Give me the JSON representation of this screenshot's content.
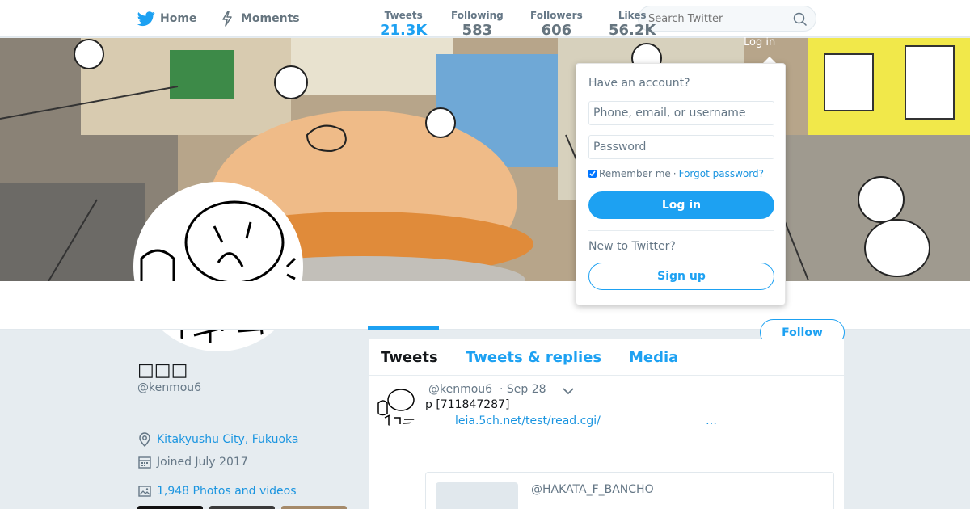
{
  "nav": {
    "home_label": "Home",
    "moments_label": "Moments",
    "search_placeholder": "Search Twitter",
    "login_label": "Log in"
  },
  "profile": {
    "name": "□□□",
    "handle": "@kenmou6",
    "location": "Kitakyushu City, Fukuoka",
    "joined": "Joined July 2017",
    "photos_link": "1,948 Photos and videos",
    "follow_label": "Follow"
  },
  "stats": [
    {
      "label": "Tweets",
      "value": "21.3K"
    },
    {
      "label": "Following",
      "value": "583"
    },
    {
      "label": "Followers",
      "value": "606"
    },
    {
      "label": "Likes",
      "value": "56.2K"
    }
  ],
  "tabs": [
    {
      "label": "Tweets"
    },
    {
      "label": "Tweets & replies"
    },
    {
      "label": "Media"
    }
  ],
  "tweet": {
    "handle": "@kenmou6",
    "date": "· Sep 28",
    "text": "p  [711847287]",
    "link": "leia.5ch.net/test/read.cgi/",
    "ellipsis": "…",
    "quote_handle": "@HAKATA_F_BANCHO"
  },
  "login_dropdown": {
    "title": "Have an account?",
    "username_placeholder": "Phone, email, or username",
    "password_placeholder": "Password",
    "remember_label": "Remember me",
    "separator": "·",
    "forgot_label": "Forgot password?",
    "login_button": "Log in",
    "new_title": "New to Twitter?",
    "signup_button": "Sign up"
  },
  "colors": {
    "brand": "#1da1f2",
    "link": "#1b95e0",
    "background": "#e6ecf0"
  }
}
